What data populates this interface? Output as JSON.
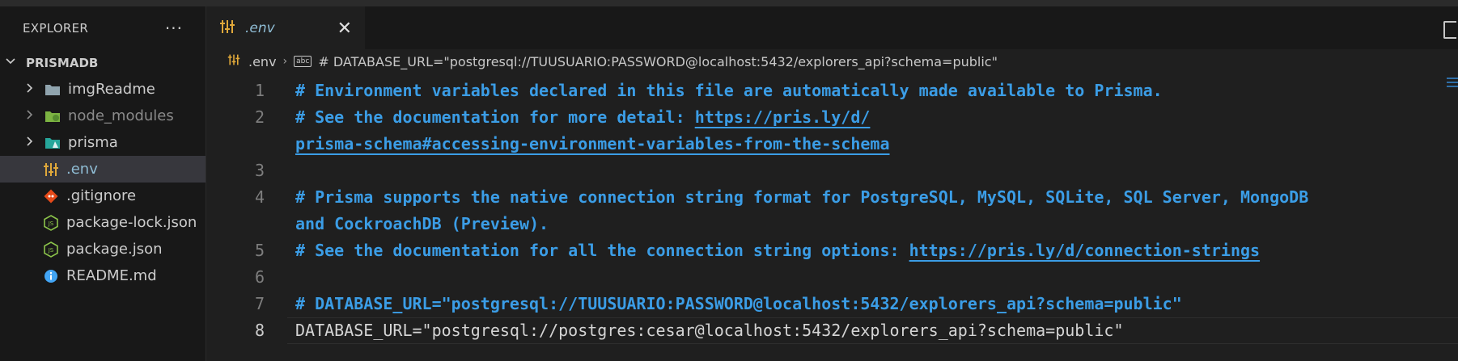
{
  "sidebar": {
    "title": "EXPLORER",
    "more_label": "···",
    "project": "PRISMADB",
    "items": [
      {
        "label": "imgReadme",
        "icon": "folder-icon"
      },
      {
        "label": "node_modules",
        "icon": "node-modules-folder-icon"
      },
      {
        "label": "prisma",
        "icon": "prisma-folder-icon"
      },
      {
        "label": ".env",
        "icon": "env-settings-icon"
      },
      {
        "label": ".gitignore",
        "icon": "git-icon"
      },
      {
        "label": "package-lock.json",
        "icon": "nodejs-icon"
      },
      {
        "label": "package.json",
        "icon": "nodejs-icon"
      },
      {
        "label": "README.md",
        "icon": "info-icon"
      }
    ]
  },
  "tabs": [
    {
      "label": ".env",
      "close": "✕"
    }
  ],
  "breadcrumb": {
    "file": ".env",
    "symbol": "# DATABASE_URL=\"postgresql://TUUSUARIO:PASSWORD@localhost:5432/explorers_api?schema=public\""
  },
  "editor": {
    "active_line": "8",
    "lines": [
      {
        "n": "1",
        "a": "# Environment variables declared in this file are automatically made available to Prisma."
      },
      {
        "n": "2",
        "a": "# See the documentation for more detail: ",
        "link": "https://pris.ly/d/"
      },
      {
        "n": "",
        "link": "prisma-schema#accessing-environment-variables-from-the-schema"
      },
      {
        "n": "3"
      },
      {
        "n": "4",
        "a": "# Prisma supports the native connection string format for PostgreSQL, MySQL, SQLite, SQL Server, MongoDB"
      },
      {
        "n": "",
        "a": "and CockroachDB (Preview)."
      },
      {
        "n": "5",
        "a": "# See the documentation for all the connection string options: ",
        "link": "https://pris.ly/d/connection-strings"
      },
      {
        "n": "6"
      },
      {
        "n": "7",
        "a": "# DATABASE_URL=\"postgresql://TUUSUARIO:PASSWORD@localhost:5432/explorers_api?schema=public\""
      },
      {
        "n": "8",
        "plain": "DATABASE_URL=\"postgresql://postgres:cesar@localhost:5432/explorers_api?schema=public\""
      }
    ]
  },
  "colors": {
    "comment": "#3b9de6",
    "selected_row": "#37373d"
  }
}
